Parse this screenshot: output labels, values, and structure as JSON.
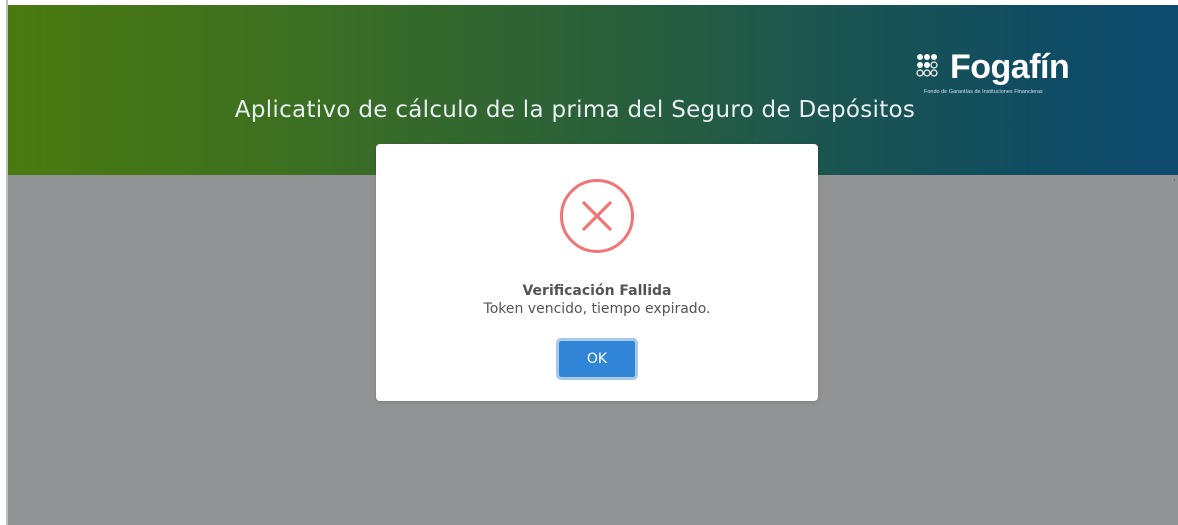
{
  "header": {
    "title": "Aplicativo de cálculo de la prima del Seguro de Depósitos",
    "logo": {
      "name": "Fogafín",
      "subtitle": "Fondo de Garantías de Instituciones Financieras"
    }
  },
  "dialog": {
    "icon": "error-x-icon",
    "title": "Verificación Fallida",
    "message": "Token vencido, tiempo expirado.",
    "ok_label": "OK"
  },
  "colors": {
    "header_gradient_start": "#4a7a0f",
    "header_gradient_end": "#0d4a6e",
    "overlay": "#929394",
    "error_icon": "#f27474",
    "ok_button": "#3085d6"
  }
}
